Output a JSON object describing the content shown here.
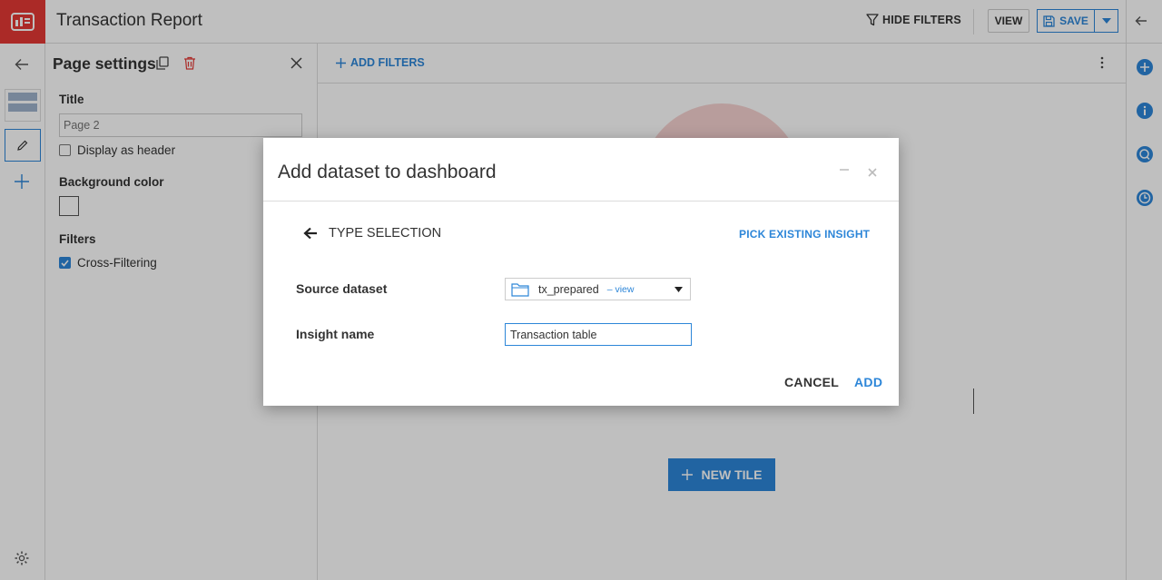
{
  "header": {
    "title": "Transaction Report",
    "hide_filters_label": "HIDE FILTERS",
    "view_label": "VIEW",
    "save_label": "SAVE"
  },
  "page_settings": {
    "title": "Page settings",
    "title_field_label": "Title",
    "title_placeholder": "Page 2",
    "display_as_header_label": "Display as header",
    "display_as_header_checked": false,
    "background_color_label": "Background color",
    "filters_label": "Filters",
    "cross_filtering_label": "Cross-Filtering",
    "cross_filtering_checked": true
  },
  "main": {
    "add_filters_label": "ADD FILTERS",
    "new_tile_label": "NEW TILE"
  },
  "modal": {
    "title": "Add dataset to dashboard",
    "type_selection_label": "TYPE SELECTION",
    "pick_existing_label": "PICK EXISTING INSIGHT",
    "source_dataset_label": "Source dataset",
    "source_dataset_value": "tx_prepared",
    "source_dataset_view_link": "– view",
    "insight_name_label": "Insight name",
    "insight_name_value": "Transaction table",
    "cancel_label": "CANCEL",
    "add_label": "ADD"
  },
  "colors": {
    "accent": "#2d86d8",
    "brand": "#e53935"
  }
}
